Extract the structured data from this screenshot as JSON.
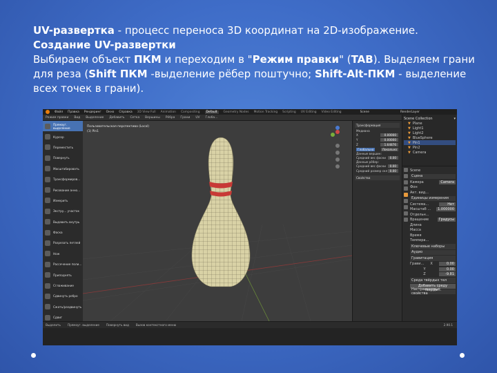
{
  "slide": {
    "line1_bold": "UV-развертка",
    "line1_rest": " - процесс переноса 3D координат на 2D-изображение.",
    "line2_bold": "Создание UV-развертки",
    "line3_a": "Выбираем объект ",
    "line3_b": "ПКМ",
    "line3_c": " и переходим в \"",
    "line3_d": "Режим правки",
    "line3_e": "\" (",
    "line3_f": "TAB",
    "line3_g": "). Выделяем грани для реза (",
    "line3_h": "Shift ПКМ",
    "line3_i": " -выделение рёбер поштучно; ",
    "line3_j": "Shift-Alt-ПКМ",
    "line3_k": " - выделение всех точек в грани)."
  },
  "colors": {
    "background": "#3f6dc8",
    "active_tool": "#4772b3",
    "outliner_accent": "#e89a3c"
  },
  "blender": {
    "topbar": {
      "menus": [
        "Файл",
        "Правка",
        "Рендеринг",
        "Окно",
        "Справка"
      ],
      "workspaces": [
        "3D View Full",
        "Animation",
        "Compositing",
        "Default",
        "Geometry Nodes",
        "Motion Tracking",
        "Scripting",
        "UV Editing",
        "Video Editing"
      ],
      "active_workspace": "Default",
      "scene": "Scene",
      "view_layer": "RenderLayer"
    },
    "header": {
      "mode": "Режим правки",
      "menus": [
        "Вид",
        "Выделение",
        "Добавить",
        "Сетка",
        "Вершины",
        "Рёбра",
        "Грани",
        "UV"
      ],
      "orientation": "Глоба..."
    },
    "tools": [
      "Прямоуг. выделение",
      "Курсор",
      "Переместить",
      "Повернуть",
      "Масштабировать",
      "Трансформиров...",
      "Рисование анно...",
      "Измерить",
      "Экстру... участок",
      "Выдавить внутрь",
      "Фаска",
      "Разрезать петлей",
      "Нож",
      "Рассечение поли...",
      "Приподнять",
      "Сглаживание",
      "Сдвинуть ребро",
      "Сжать/раздвинуть",
      "Сдвиг",
      "Отделить облас..."
    ],
    "active_tool_index": 0,
    "viewport": {
      "title": "Пользовательская перспектива (Local)",
      "subtitle": "(1) Pin1"
    },
    "npanel": {
      "section": "Трансформация",
      "median_label": "Медиана",
      "coords": [
        {
          "axis": "X",
          "value": "0.00000"
        },
        {
          "axis": "Y",
          "value": "0.00000"
        },
        {
          "axis": "Z",
          "value": "1.64876"
        }
      ],
      "global_label": "Глобально",
      "local_label": "Локально",
      "vertex_data": "Данные вершин:",
      "vertex_row": "Средний вес фаски",
      "vertex_val": "0.00",
      "edge_data": "Данные рёбер:",
      "edge_row1": "Средний вес фаски",
      "edge_val1": "0.00",
      "edge_row2": "Средний размер скл",
      "edge_val2": "0.00",
      "properties": "Свойства"
    },
    "outliner": {
      "title": "Scene Collection",
      "items": [
        "Plane",
        "Light1",
        "Light2",
        "BlueSphere",
        "Pin1",
        "Pin2",
        "Camera"
      ],
      "selected": "Pin1"
    },
    "properties": {
      "scene_label": "Scene",
      "sec_scene": "Сцена",
      "camera_label": "Камера",
      "camera_value": "Camera",
      "bg_label": "Фон",
      "active_clip": "Акт. вид...",
      "sec_units": "Единицы измерения",
      "system_label": "Система...",
      "system_value": "Нет",
      "scale_label": "Масштаб ...",
      "scale_value": "1.000000",
      "sep_label": "Отдельн...",
      "rotation_label": "Вращение",
      "rotation_value": "Градусы",
      "length_label": "Длина",
      "mass_label": "Масса",
      "time_label": "Время",
      "temp_label": "Темпера...",
      "sec_keysets": "Ключевые наборы",
      "sec_audio": "Аудио",
      "sec_gravity": "Гравитация",
      "gravity_label": "Грави...",
      "gravity": [
        {
          "axis": "X",
          "value": "0.00"
        },
        {
          "axis": "Y",
          "value": "0.00"
        },
        {
          "axis": "Z",
          "value": "-9.81"
        }
      ],
      "sec_rigid": "Среда твёрдых тел",
      "add_rigid": "Добавить среду твёрды...",
      "sec_custom": "Настраиваемые свойства"
    },
    "status": {
      "select": "Выделить",
      "box": "Прямоуг. выделение",
      "rotate": "Повернуть вид",
      "menu": "Вызов контекстного меню",
      "version": "2.90.1"
    }
  }
}
